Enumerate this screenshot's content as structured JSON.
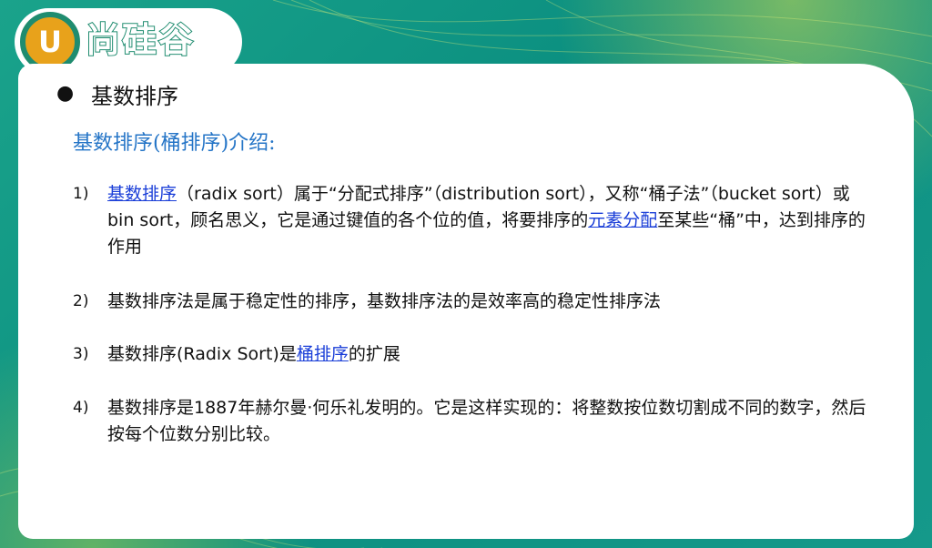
{
  "logo": {
    "letter": "U",
    "brand": "尚硅谷"
  },
  "slide": {
    "bullet": "●",
    "title": "基数排序",
    "subtitle": "基数排序(桶排序)介绍:",
    "items": [
      {
        "num": "1)",
        "link1": "基数排序",
        "text1": "（radix sort）属于“分配式排序”（distribution sort），又称“桶子法”（bucket sort）或bin sort，顾名思义，它是通过键值的各个位的值，将要排序的",
        "link2": "元素分配",
        "text2": "至某些“桶”中，达到排序的作用"
      },
      {
        "num": "2)",
        "text": "基数排序法是属于稳定性的排序，基数排序法的是效率高的稳定性排序法"
      },
      {
        "num": "3)",
        "text1": "基数排序(Radix Sort)是",
        "link": "桶排序",
        "text2": "的扩展"
      },
      {
        "num": "4)",
        "text": "基数排序是1887年赫尔曼·何乐礼发明的。它是这样实现的：将整数按位数切割成不同的数字，然后按每个位数分别比较。"
      }
    ]
  },
  "colors": {
    "accent": "#2575c7",
    "link": "#1a3ed8",
    "brand_green": "#1f8c6f",
    "brand_orange": "#e8a21b"
  }
}
